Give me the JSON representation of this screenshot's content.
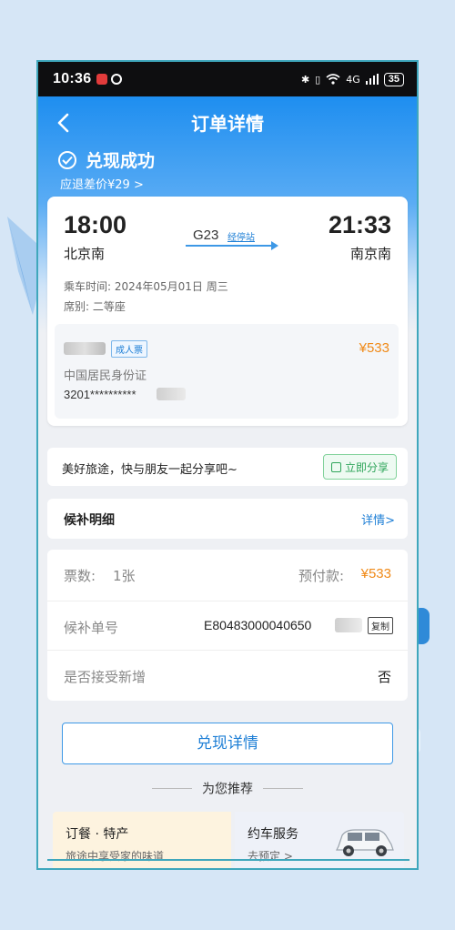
{
  "status_bar": {
    "time": "10:36",
    "network": "4G",
    "battery": "35"
  },
  "nav": {
    "title": "订单详情"
  },
  "status": {
    "success_text": "兑现成功",
    "refund_text": "应退差价¥29 >"
  },
  "ticket": {
    "departure_time": "18:00",
    "departure_station": "北京南",
    "train_number": "G23",
    "via_stations_link": "经停站",
    "arrival_time": "21:33",
    "arrival_station": "南京南",
    "ride_date": "乘车时间: 2024年05月01日 周三",
    "seat_class": "席别: 二等座"
  },
  "passenger": {
    "ticket_type": "成人票",
    "price": "¥533",
    "id_type": "中国居民身份证",
    "id_number": "3201**********"
  },
  "share": {
    "text": "美好旅途，快与朋友一起分享吧~",
    "button_label": "立即分享"
  },
  "waitlist": {
    "title": "候补明细",
    "detail_link": "详情>"
  },
  "order_info": {
    "ticket_count_label": "票数:",
    "ticket_count_value": "1张",
    "prepay_label": "预付款:",
    "prepay_value": "¥533",
    "order_number_label": "候补单号",
    "order_number_value": "E80483000040650",
    "copy_label": "复制",
    "accept_new_label": "是否接受新增",
    "accept_new_value": "否"
  },
  "redeem_button": "兑现详情",
  "recommend_title": "为您推荐",
  "promos": [
    {
      "title": "订餐 · 特产",
      "subtitle": "旅途中享受家的味道"
    },
    {
      "title": "约车服务",
      "subtitle": "去预定 >"
    }
  ],
  "colors": {
    "header_blue": "#1e8ef0",
    "link_blue": "#1e7fd6",
    "price_orange": "#f08a18",
    "share_green": "#2fa55a",
    "frame_teal": "#3fa7bc"
  }
}
